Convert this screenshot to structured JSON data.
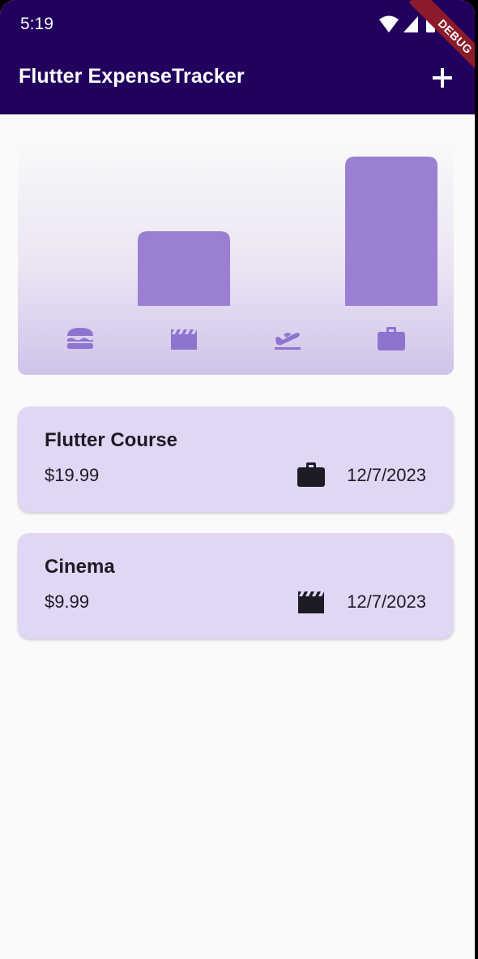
{
  "status_bar": {
    "time": "5:19"
  },
  "app_bar": {
    "title": "Flutter ExpenseTracker",
    "add_icon": "plus-icon"
  },
  "debug_banner": "DEBUG",
  "colors": {
    "app_bar": "#22005d",
    "bar_fill": "#9b7fd3",
    "chart_icon": "#8f74cf",
    "card_bg": "#e1d6f4",
    "card_icon": "#1d1b24"
  },
  "chart_data": {
    "type": "bar",
    "categories": [
      "food",
      "leisure",
      "travel",
      "work"
    ],
    "category_icons": [
      "burger-icon",
      "clapperboard-icon",
      "plane-takeoff-icon",
      "briefcase-icon"
    ],
    "values": [
      0,
      9.99,
      0,
      19.99
    ],
    "ylim": [
      0,
      19.99
    ],
    "title": "",
    "xlabel": "",
    "ylabel": ""
  },
  "expenses": [
    {
      "title": "Flutter Course",
      "amount": "$19.99",
      "date": "12/7/2023",
      "category_icon": "briefcase-icon"
    },
    {
      "title": "Cinema",
      "amount": "$9.99",
      "date": "12/7/2023",
      "category_icon": "clapperboard-icon"
    }
  ]
}
